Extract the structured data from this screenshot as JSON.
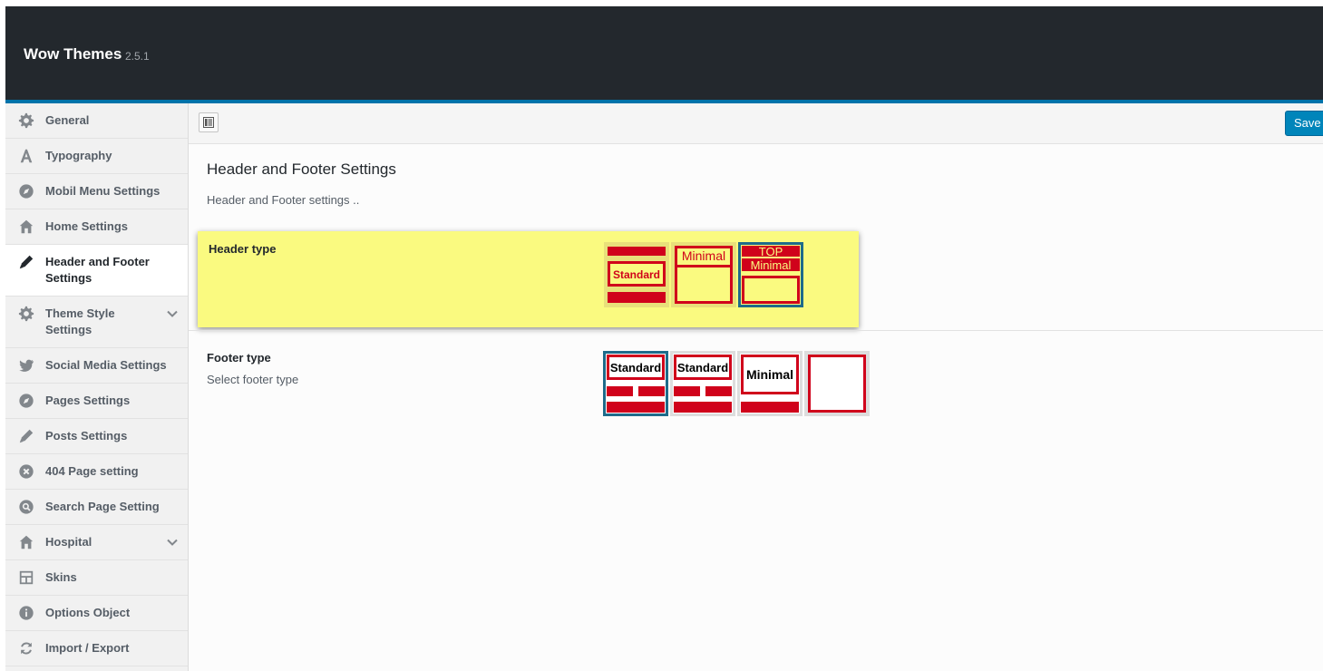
{
  "app": {
    "title": "Wow Themes",
    "version": "2.5.1"
  },
  "sidebar": {
    "items": [
      {
        "label": "General",
        "icon": "gear-icon"
      },
      {
        "label": "Typography",
        "icon": "font-icon"
      },
      {
        "label": "Mobil Menu Settings",
        "icon": "compass-icon"
      },
      {
        "label": "Home Settings",
        "icon": "home-icon"
      },
      {
        "label": "Header and Footer Settings",
        "icon": "pencil-icon",
        "active": true
      },
      {
        "label": "Theme Style Settings",
        "icon": "gear-icon",
        "expandable": true
      },
      {
        "label": "Social Media Settings",
        "icon": "twitter-icon"
      },
      {
        "label": "Pages Settings",
        "icon": "compass-icon"
      },
      {
        "label": "Posts Settings",
        "icon": "pencil-icon"
      },
      {
        "label": "404 Page setting",
        "icon": "dismiss-icon"
      },
      {
        "label": "Search Page Setting",
        "icon": "search-icon"
      },
      {
        "label": "Hospital",
        "icon": "home-icon",
        "expandable": true
      },
      {
        "label": "Skins",
        "icon": "layout-icon"
      },
      {
        "label": "Options Object",
        "icon": "info-icon"
      },
      {
        "label": "Import / Export",
        "icon": "refresh-icon"
      }
    ]
  },
  "toolbar": {
    "save_label": "Save Changes"
  },
  "section": {
    "title": "Header and Footer Settings",
    "description": "Header and Footer settings .."
  },
  "header_type": {
    "title": "Header type",
    "options": [
      {
        "label": "Standard"
      },
      {
        "label": "Minimal"
      },
      {
        "label_top": "TOP",
        "label": "Minimal",
        "selected": true
      }
    ]
  },
  "footer_type": {
    "title": "Footer type",
    "subtitle": "Select footer type",
    "options": [
      {
        "label": "Standard",
        "selected": true
      },
      {
        "label": "Standard"
      },
      {
        "label": "Minimal"
      },
      {
        "label": ""
      }
    ]
  },
  "colors": {
    "topbar": "#23282d",
    "accent": "#0073aa",
    "highlight": "#fafa80",
    "option_red": "#d0021b",
    "selected_border": "#1e6b8a"
  }
}
